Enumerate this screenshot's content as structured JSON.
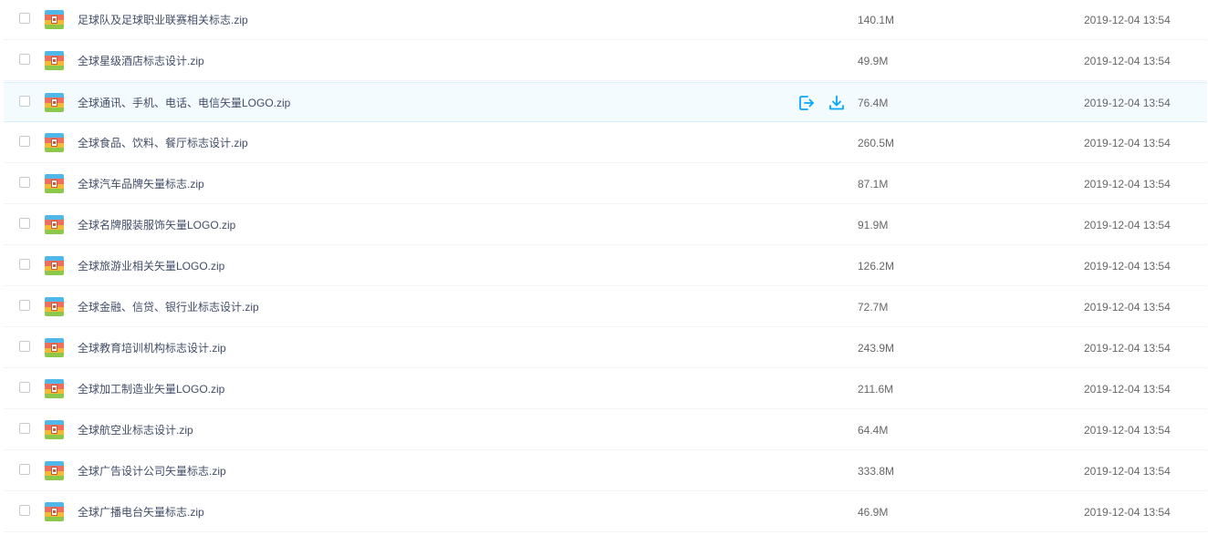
{
  "colors": {
    "accent": "#06a7ff",
    "hover_background": "#f4fbff",
    "name_text": "#424e67",
    "meta_text": "#666666"
  },
  "files": [
    {
      "name": "足球队及足球职业联赛相关标志.zip",
      "size": "140.1M",
      "date": "2019-12-04 13:54",
      "icon": "zip-archive-icon"
    },
    {
      "name": "全球星级酒店标志设计.zip",
      "size": "49.9M",
      "date": "2019-12-04 13:54",
      "icon": "zip-archive-icon"
    },
    {
      "name": "全球通讯、手机、电话、电信矢量LOGO.zip",
      "size": "76.4M",
      "date": "2019-12-04 13:54",
      "icon": "zip-archive-icon",
      "hovered": true,
      "actions": [
        "share-icon",
        "download-icon"
      ]
    },
    {
      "name": "全球食品、饮料、餐厅标志设计.zip",
      "size": "260.5M",
      "date": "2019-12-04 13:54",
      "icon": "zip-archive-icon"
    },
    {
      "name": "全球汽车品牌矢量标志.zip",
      "size": "87.1M",
      "date": "2019-12-04 13:54",
      "icon": "zip-archive-icon"
    },
    {
      "name": "全球名牌服装服饰矢量LOGO.zip",
      "size": "91.9M",
      "date": "2019-12-04 13:54",
      "icon": "zip-archive-icon"
    },
    {
      "name": "全球旅游业相关矢量LOGO.zip",
      "size": "126.2M",
      "date": "2019-12-04 13:54",
      "icon": "zip-archive-icon"
    },
    {
      "name": "全球金融、信贷、银行业标志设计.zip",
      "size": "72.7M",
      "date": "2019-12-04 13:54",
      "icon": "zip-archive-icon"
    },
    {
      "name": "全球教育培训机构标志设计.zip",
      "size": "243.9M",
      "date": "2019-12-04 13:54",
      "icon": "zip-archive-icon"
    },
    {
      "name": "全球加工制造业矢量LOGO.zip",
      "size": "211.6M",
      "date": "2019-12-04 13:54",
      "icon": "zip-archive-icon"
    },
    {
      "name": "全球航空业标志设计.zip",
      "size": "64.4M",
      "date": "2019-12-04 13:54",
      "icon": "zip-archive-icon"
    },
    {
      "name": "全球广告设计公司矢量标志.zip",
      "size": "333.8M",
      "date": "2019-12-04 13:54",
      "icon": "zip-archive-icon"
    },
    {
      "name": "全球广播电台矢量标志.zip",
      "size": "46.9M",
      "date": "2019-12-04 13:54",
      "icon": "zip-archive-icon"
    }
  ]
}
